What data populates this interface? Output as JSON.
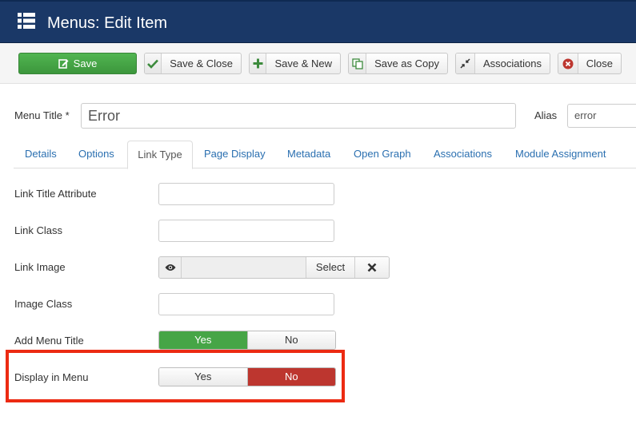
{
  "header": {
    "title": "Menus: Edit Item",
    "icon": "list-icon"
  },
  "toolbar": {
    "save": "Save",
    "save_close": "Save & Close",
    "save_new": "Save & New",
    "save_copy": "Save as Copy",
    "associations": "Associations",
    "close": "Close"
  },
  "form": {
    "menu_title_label": "Menu Title *",
    "menu_title_value": "Error",
    "alias_label": "Alias",
    "alias_value": "error"
  },
  "tabs": [
    {
      "label": "Details"
    },
    {
      "label": "Options"
    },
    {
      "label": "Link Type",
      "active": true
    },
    {
      "label": "Page Display"
    },
    {
      "label": "Metadata"
    },
    {
      "label": "Open Graph"
    },
    {
      "label": "Associations"
    },
    {
      "label": "Module Assignment"
    }
  ],
  "fields": {
    "link_title_attribute": "Link Title Attribute",
    "link_class": "Link Class",
    "link_image": "Link Image",
    "link_image_select": "Select",
    "image_class": "Image Class",
    "add_menu_title": "Add Menu Title",
    "add_menu_title_yes": "Yes",
    "add_menu_title_no": "No",
    "add_menu_title_selected": "Yes",
    "display_in_menu": "Display in Menu",
    "display_in_menu_yes": "Yes",
    "display_in_menu_no": "No",
    "display_in_menu_selected": "No"
  },
  "colors": {
    "header_bg": "#1a3867",
    "save_green": "#46a546",
    "no_red": "#bd362f",
    "link_blue": "#2a6fb0",
    "highlight_red": "#ec2a12"
  }
}
